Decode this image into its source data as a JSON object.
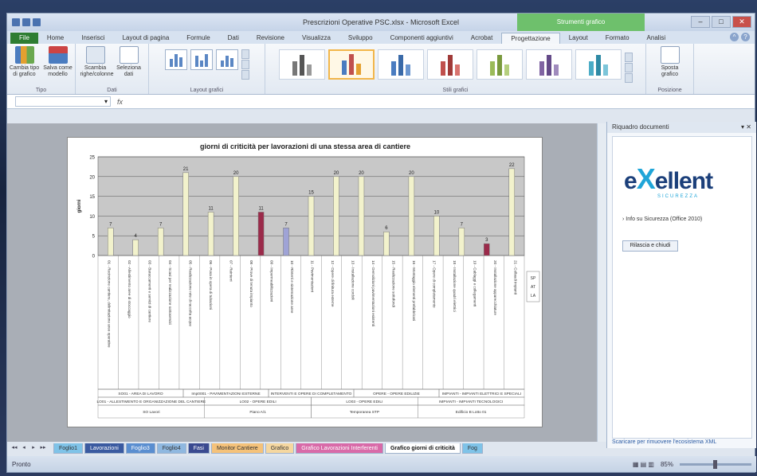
{
  "window": {
    "title": "Prescrizioni Operative PSC.xlsx - Microsoft Excel",
    "context_tab": "Strumenti grafico"
  },
  "tabs": [
    "File",
    "Home",
    "Inserisci",
    "Layout di pagina",
    "Formule",
    "Dati",
    "Revisione",
    "Visualizza",
    "Sviluppo",
    "Componenti aggiuntivi",
    "Acrobat",
    "Progettazione",
    "Layout",
    "Formato",
    "Analisi"
  ],
  "ribbon": {
    "tipo": {
      "label": "Tipo",
      "buttons": [
        "Cambia tipo di grafico",
        "Salva come modello"
      ]
    },
    "dati": {
      "label": "Dati",
      "buttons": [
        "Scambia righe/colonne",
        "Seleziona dati"
      ]
    },
    "layout": {
      "label": "Layout grafici"
    },
    "stili": {
      "label": "Stili grafici"
    },
    "posizione": {
      "label": "Posizione",
      "buttons": [
        "Sposta grafico"
      ]
    }
  },
  "formula": {
    "namebox": "",
    "fx": "fx"
  },
  "chart_data": {
    "type": "bar",
    "title": "giorni di criticità per lavorazioni di una stessa area di cantiere",
    "ylabel": "giorni",
    "ylim": [
      0,
      25
    ],
    "yticks": [
      0,
      5,
      10,
      15,
      20,
      25
    ],
    "grid": true,
    "categories": [
      "01 - Recinzione cantiere, delimitazione aree operative",
      "02 - Allestimento aree di stoccaggio",
      "03 - Baraccamenti e servizi di cantiere",
      "04 - Scavi per realizzazione sottoservizi",
      "05 - Realizzazione rete di raccolta acque",
      "06 - Posa in opera di tubazioni",
      "07 - Reinterri",
      "08 - Prove di tenuta impianto",
      "09 - Impermeabilizzazioni",
      "10 - Rinterri e sistemazione aree",
      "11 - Pavimentazioni",
      "12 - Opere di finitura esterne",
      "13 - Installazione cordoli",
      "14 - Demolizioni pavimentazioni esistenti",
      "15 - Realizzazione sottofondi",
      "16 - Montaggio elementi prefabbricati",
      "17 - Opere di completamento",
      "18 - Installazione quadri elettrici",
      "19 - Cablaggi e collegamenti",
      "20 - Installazione apparecchiature",
      "21 - Collaudi impianti"
    ],
    "values": [
      7,
      4,
      7,
      21,
      11,
      20,
      11,
      7,
      15,
      20,
      20,
      6,
      20,
      10,
      7,
      3,
      22
    ],
    "bar_colors": [
      "#f2f2cc",
      "#f2f2cc",
      "#f2f2cc",
      "#f2f2cc",
      "#f2f2cc",
      "#f2f2cc",
      "#9b2a4a",
      "#9fa3d6",
      "#f2f2cc",
      "#f2f2cc",
      "#f2f2cc",
      "#f2f2cc",
      "#f2f2cc",
      "#f2f2cc",
      "#f2f2cc",
      "#9b2a4a",
      "#f2f2cc"
    ],
    "group_labels_row1": [
      "SO01 - AREA DI LAVORO",
      "Imp0001 - PAVIMENTAZIONI ESTERNE",
      "INTERVENTI E OPERE DI COMPLETAMENTO",
      "OPERE - OPERE EDILIZIE",
      "IMPIANTI - IMPIANTI ELETTRICI E SPECIALI"
    ],
    "group_labels_row2": [
      "LO01 - ALLESTIMENTO E ORGANIZZAZIONE DEL CANTIERE",
      "LO02 - OPERE EDILI",
      "LO03 - OPERE EDILI",
      "IMPIANTI - IMPIANTI TECNOLOGICI"
    ],
    "group_labels_row3": [
      "SO Lavori",
      "Piano A/1",
      "Temporanea STP",
      "Edificio B Lotto 01"
    ],
    "legend": [
      "SP",
      "AT",
      "LA"
    ]
  },
  "taskpane": {
    "title": "Riquadro documenti",
    "logo_main": "ellent",
    "logo_prefix": "e",
    "logo_x": "X",
    "logo_sub": "SICUREZZA",
    "link": "Info su Sicurezza (Office 2010)",
    "button": "Rilascia e chiudi",
    "footer": "Scaricare per rimuovere l'ecosistema XML"
  },
  "sheet_tabs": [
    "Foglio1",
    "Lavorazioni",
    "Foglio3",
    "Foglio4",
    "Fasi",
    "Monitor Cantiere",
    "Grafico",
    "Grafico Lavorazioni Interferenti",
    "Grafico giorni di criticità",
    "Fog"
  ],
  "status": {
    "left": "Pronto",
    "zoom": "85%"
  }
}
